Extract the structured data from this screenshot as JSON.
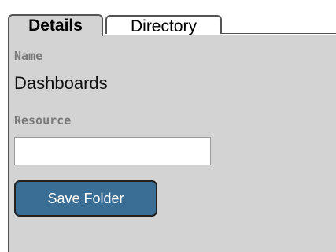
{
  "tabs": [
    {
      "label": "Details",
      "active": true
    },
    {
      "label": "Directory",
      "active": false
    }
  ],
  "form": {
    "name_label": "Name",
    "name_value": "Dashboards",
    "resource_label": "Resource",
    "resource_value": "",
    "save_label": "Save Folder"
  },
  "colors": {
    "panel_bg": "#d3d3d3",
    "button_bg": "#3b6e95",
    "label_text": "#7a7a7a"
  }
}
